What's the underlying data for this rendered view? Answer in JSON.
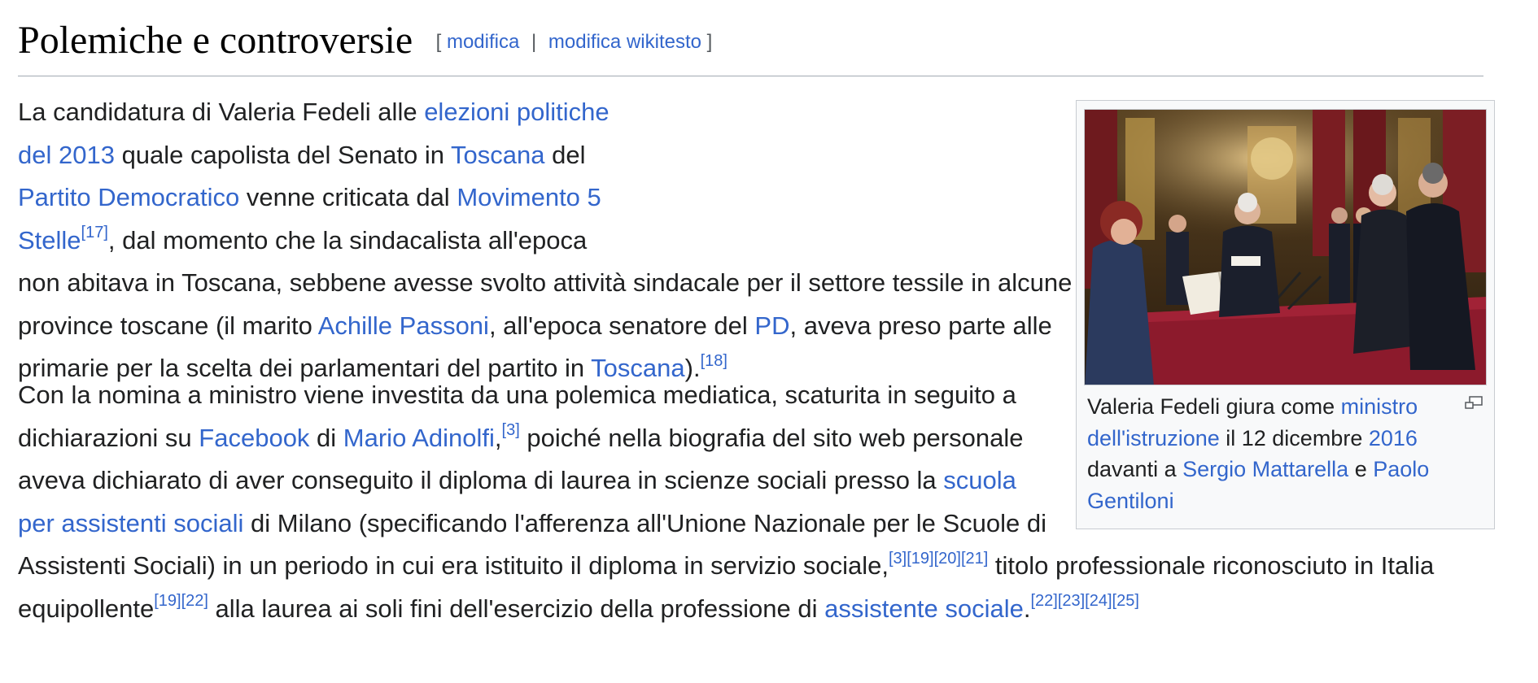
{
  "section": {
    "title": "Polemiche e controversie",
    "edit": {
      "open_bracket": "[",
      "modifica": "modifica",
      "separator": "|",
      "modifica_wikitesto": "modifica wikitesto",
      "close_bracket": "]"
    }
  },
  "paragraph1": {
    "t1": "La candidatura di Valeria Fedeli alle ",
    "l_elezioni": "elezioni politiche del 2013",
    "t2": " quale capolista del Senato in ",
    "l_toscana": "Toscana",
    "t3": " del ",
    "l_pd_full": "Partito Democratico",
    "t4": " venne criticata dal ",
    "l_m5s": "Movimento 5 Stelle",
    "r17": "[17]",
    "t5": ", dal momento che la sindacalista all'epoca non abitava in Toscana, sebbene avesse svolto attività sindacale per il settore tessile in alcune province toscane (il marito ",
    "l_passoni": "Achille Passoni",
    "t6": ", all'epoca senatore del ",
    "l_pd": "PD",
    "t7": ", aveva preso parte alle primarie per la scelta dei parlamentari del partito in ",
    "l_toscana2": "Toscana",
    "t8": ").",
    "r18": "[18]"
  },
  "paragraph2": {
    "t1": "Con la nomina a ministro viene investita da una polemica mediatica, scaturita in seguito a dichiarazioni su ",
    "l_facebook": "Facebook",
    "t2": " di ",
    "l_adinolfi": "Mario Adinolfi",
    "t3": ",",
    "r3": "[3]",
    "t4": " poiché nella biografia del sito web personale aveva dichiarato di aver conseguito il diploma di laurea in scienze sociali presso la ",
    "l_scuola": "scuola per assistenti sociali",
    "t5": " di Milano (specificando l'afferenza all'Unione Nazionale per le Scuole di Assistenti Sociali) in un periodo in cui era istituito il diploma in servizio sociale,",
    "r3b": "[3]",
    "r19": "[19]",
    "r20": "[20]",
    "r21": "[21]",
    "t6": " titolo professionale riconosciuto in Italia equipollente",
    "r19b": "[19]",
    "r22": "[22]",
    "t7": " alla laurea ai soli fini dell'esercizio della professione di ",
    "l_assistente": "assistente sociale",
    "t8": ".",
    "r22b": "[22]",
    "r23": "[23]",
    "r24": "[24]",
    "r25": "[25]"
  },
  "thumbnail": {
    "caption": {
      "t1": "Valeria Fedeli giura come ",
      "l_ministro": "ministro dell'istruzione",
      "t2": " il 12 dicembre ",
      "l_2016": "2016",
      "t3": " davanti a ",
      "l_mattarella": "Sergio Mattarella",
      "t4": " e ",
      "l_gentiloni": "Paolo Gentiloni"
    },
    "magnify_icon": "enlarge-icon"
  },
  "colors": {
    "link": "#3366cc",
    "text": "#202122",
    "heading_border": "#a2a9b1",
    "thumb_background": "#f8f9fa",
    "thumb_border": "#c8ccd1"
  }
}
